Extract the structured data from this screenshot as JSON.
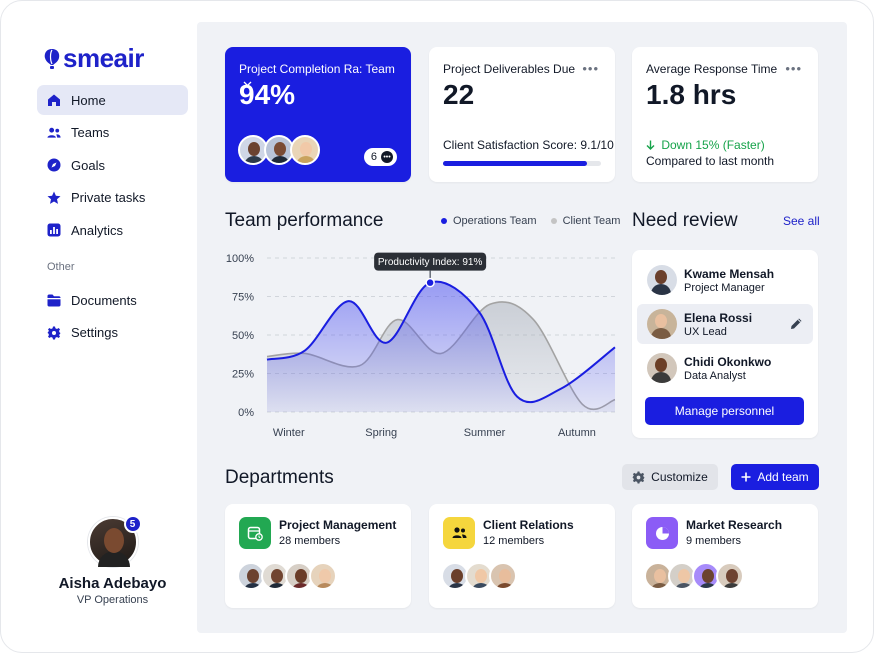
{
  "brand": {
    "name": "smeair"
  },
  "sidebar": {
    "items": [
      {
        "label": "Home",
        "icon": "home-icon",
        "active": true
      },
      {
        "label": "Teams",
        "icon": "users-icon",
        "active": false
      },
      {
        "label": "Goals",
        "icon": "compass-icon",
        "active": false
      },
      {
        "label": "Private tasks",
        "icon": "star-icon",
        "active": false
      },
      {
        "label": "Analytics",
        "icon": "chart-icon",
        "active": false
      }
    ],
    "other_label": "Other",
    "other_items": [
      {
        "label": "Documents",
        "icon": "folder-icon"
      },
      {
        "label": "Settings",
        "icon": "gear-icon"
      }
    ],
    "profile": {
      "name": "Aisha Adebayo",
      "role": "VP Operations",
      "notifications": "5"
    }
  },
  "stats": {
    "completion": {
      "label": "Project Completion Ra: Team",
      "value": "94%",
      "extra_count": "6"
    },
    "deliverables": {
      "label": "Project Deliverables Due",
      "value": "22",
      "sub_label": "Client Satisfaction Score: 9.1/10",
      "satisfaction": 0.91
    },
    "response": {
      "label": "Average Response Time",
      "value": "1.8 hrs",
      "change": "Down 15% (Faster)",
      "compare": "Compared to last month"
    }
  },
  "performance": {
    "title": "Team performance",
    "tooltip": "Productivity Index: 91%",
    "chart_data": {
      "type": "area",
      "categories": [
        "Winter",
        "Spring",
        "Summer",
        "Autumn"
      ],
      "yticks": [
        "0%",
        "25%",
        "50%",
        "75%",
        "100%"
      ],
      "ylim": [
        0,
        100
      ],
      "series": [
        {
          "name": "Operations Team",
          "color": "#1a1ee0",
          "x": [
            0,
            0.35,
            0.75,
            1.1,
            1.5,
            1.95,
            2.3,
            2.7,
            3.2
          ],
          "values": [
            34,
            40,
            72,
            45,
            84,
            65,
            10,
            15,
            42
          ]
        },
        {
          "name": "Client Team",
          "color": "#a3a3a3",
          "x": [
            0,
            0.35,
            0.85,
            1.2,
            1.6,
            2.05,
            2.45,
            2.9,
            3.2
          ],
          "values": [
            36,
            38,
            30,
            60,
            38,
            70,
            60,
            5,
            8
          ]
        }
      ]
    }
  },
  "review": {
    "title": "Need review",
    "see_all": "See all",
    "people": [
      {
        "name": "Kwame Mensah",
        "role": "Project Manager",
        "selected": false
      },
      {
        "name": "Elena Rossi",
        "role": "UX Lead",
        "selected": true
      },
      {
        "name": "Chidi Okonkwo",
        "role": "Data Analyst",
        "selected": false
      }
    ],
    "button": "Manage personnel"
  },
  "departments": {
    "title": "Departments",
    "customize": "Customize",
    "add_team": "Add team",
    "items": [
      {
        "name": "Project Management",
        "members": "28 members",
        "icon": "calendar-icon",
        "color": "#22a852"
      },
      {
        "name": "Client Relations",
        "members": "12 members",
        "icon": "users-icon",
        "color": "#f5d63d"
      },
      {
        "name": "Market Research",
        "members": "9 members",
        "icon": "pie-chart-icon",
        "color": "#8b5cf6"
      }
    ]
  }
}
